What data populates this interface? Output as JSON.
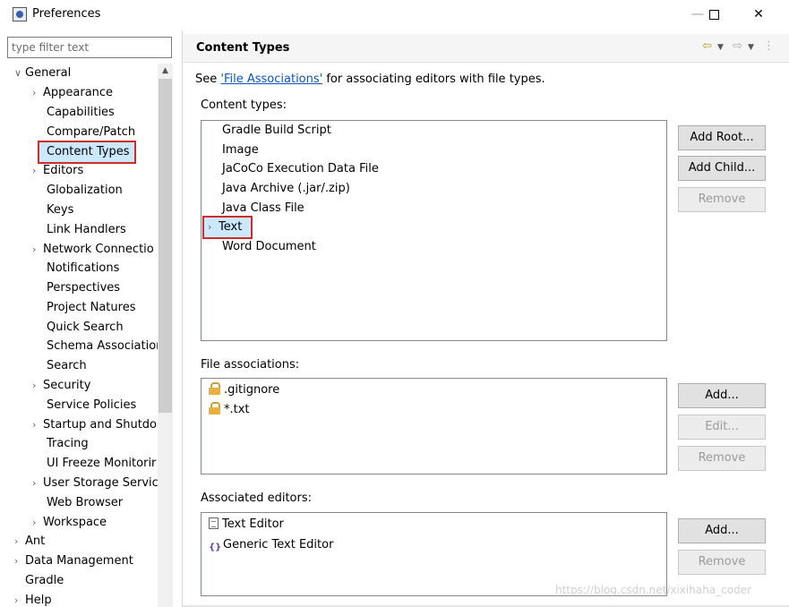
{
  "window": {
    "title": "Preferences",
    "minimize_glyph": "—",
    "close_glyph": "✕"
  },
  "sidebar": {
    "filter_placeholder": "type filter text",
    "scroll_up_glyph": "▲",
    "items": [
      {
        "label": "General",
        "arrow": "∨"
      },
      {
        "label": "Appearance",
        "arrow": "›"
      },
      {
        "label": "Capabilities",
        "arrow": ""
      },
      {
        "label": "Compare/Patch",
        "arrow": ""
      },
      {
        "label": "Content Types",
        "arrow": ""
      },
      {
        "label": "Editors",
        "arrow": "›"
      },
      {
        "label": "Globalization",
        "arrow": ""
      },
      {
        "label": "Keys",
        "arrow": ""
      },
      {
        "label": "Link Handlers",
        "arrow": ""
      },
      {
        "label": "Network Connectio",
        "arrow": "›"
      },
      {
        "label": "Notifications",
        "arrow": ""
      },
      {
        "label": "Perspectives",
        "arrow": ""
      },
      {
        "label": "Project Natures",
        "arrow": ""
      },
      {
        "label": "Quick Search",
        "arrow": ""
      },
      {
        "label": "Schema Associatior",
        "arrow": ""
      },
      {
        "label": "Search",
        "arrow": ""
      },
      {
        "label": "Security",
        "arrow": "›"
      },
      {
        "label": "Service Policies",
        "arrow": ""
      },
      {
        "label": "Startup and Shutdo",
        "arrow": "›"
      },
      {
        "label": "Tracing",
        "arrow": ""
      },
      {
        "label": "UI Freeze Monitorir",
        "arrow": ""
      },
      {
        "label": "User Storage Servic",
        "arrow": "›"
      },
      {
        "label": "Web Browser",
        "arrow": ""
      },
      {
        "label": "Workspace",
        "arrow": "›"
      },
      {
        "label": "Ant",
        "arrow": "›"
      },
      {
        "label": "Data Management",
        "arrow": "›"
      },
      {
        "label": "Gradle",
        "arrow": ""
      },
      {
        "label": "Help",
        "arrow": "›"
      }
    ]
  },
  "main": {
    "title": "Content Types",
    "nav": {
      "back": "⇦",
      "forward": "⇨",
      "drop": "▼",
      "menu": "⋮"
    },
    "desc_pre": "See ",
    "desc_link": "'File Associations'",
    "desc_post": " for associating editors with file types.",
    "content_types_label": "Content types:",
    "content_types": [
      {
        "label": "Gradle Build Script",
        "arrow": ""
      },
      {
        "label": "Image",
        "arrow": ""
      },
      {
        "label": "JaCoCo Execution Data File",
        "arrow": ""
      },
      {
        "label": "Java Archive (.jar/.zip)",
        "arrow": ""
      },
      {
        "label": "Java Class File",
        "arrow": ""
      },
      {
        "label": "Text",
        "arrow": "›"
      },
      {
        "label": "Word Document",
        "arrow": ""
      }
    ],
    "add_root": "Add Root...",
    "add_child": "Add Child...",
    "remove_ct": "Remove",
    "file_assoc_label": "File associations:",
    "file_assoc": [
      ".gitignore",
      "*.txt"
    ],
    "add_fa": "Add...",
    "edit_fa": "Edit...",
    "remove_fa": "Remove",
    "editors_label": "Associated editors:",
    "editors": [
      "Text Editor",
      "Generic Text Editor"
    ],
    "generic_icon_glyph": "{}",
    "add_ed": "Add...",
    "remove_ed": "Remove"
  },
  "watermark": "https://blog.csdn.net/xixihaha_coder"
}
